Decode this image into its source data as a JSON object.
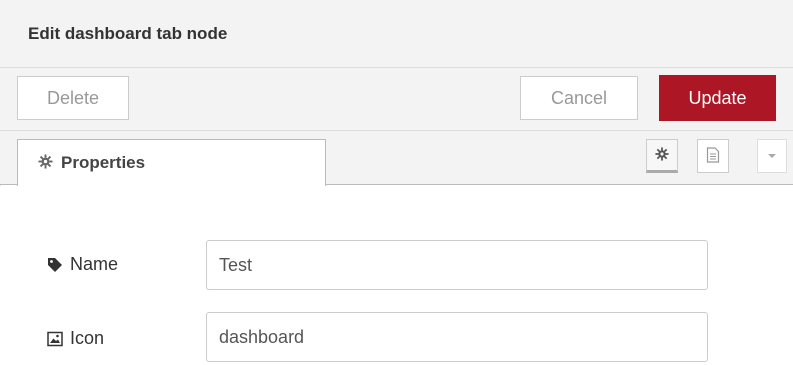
{
  "dialog": {
    "title": "Edit dashboard tab node"
  },
  "toolbar": {
    "delete_label": "Delete",
    "cancel_label": "Cancel",
    "update_label": "Update",
    "update_color": "#ad1625"
  },
  "tabs": [
    {
      "label": "Properties",
      "icon": "gear-icon",
      "active": true
    }
  ],
  "tab_tools": [
    {
      "icon": "gear-icon",
      "selected": true
    },
    {
      "icon": "document-icon",
      "selected": false
    },
    {
      "icon": "caret-down-icon",
      "selected": false
    }
  ],
  "form": {
    "name": {
      "label": "Name",
      "icon": "tag-icon",
      "value": "Test"
    },
    "icon": {
      "label": "Icon",
      "icon": "image-icon",
      "value": "dashboard"
    }
  }
}
